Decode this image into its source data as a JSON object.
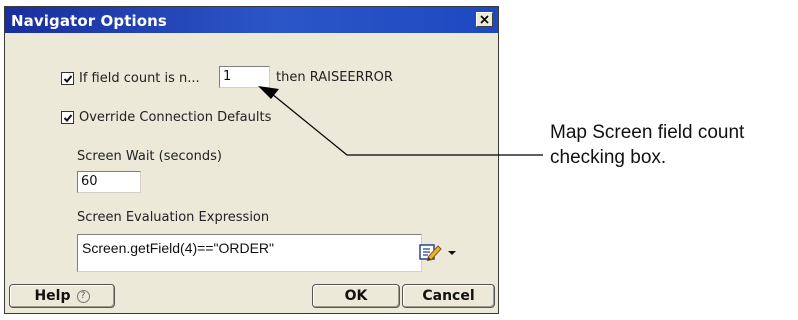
{
  "dialog": {
    "title": "Navigator Options",
    "close_icon": "close-icon"
  },
  "field_count_check": {
    "checked": true,
    "label_prefix": "If field count is n...",
    "value": "1",
    "label_suffix": "then RAISEERROR"
  },
  "override_defaults": {
    "checked": true,
    "label": "Override Connection Defaults"
  },
  "screen_wait": {
    "label": "Screen Wait (seconds)",
    "value": "60"
  },
  "screen_eval": {
    "label": "Screen Evaluation Expression",
    "value": "Screen.getField(4)==\"ORDER\"",
    "edit_icon": "edit-expression-icon",
    "dropdown_icon": "chevron-down-icon"
  },
  "buttons": {
    "help": "Help",
    "help_icon": "help-icon",
    "ok": "OK",
    "cancel": "Cancel"
  },
  "callout": {
    "line1": "Map Screen field count",
    "line2": "checking box."
  }
}
